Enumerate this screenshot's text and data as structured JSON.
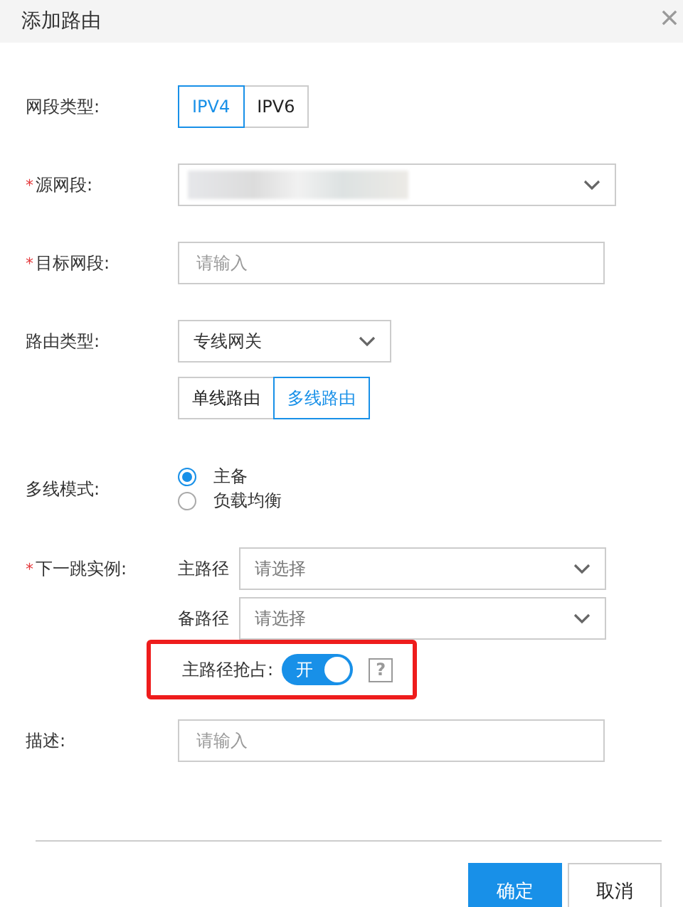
{
  "dialog": {
    "title": "添加路由"
  },
  "segment_type": {
    "label": "网段类型:",
    "options": [
      {
        "label": "IPV4",
        "selected": true
      },
      {
        "label": "IPV6",
        "selected": false
      }
    ]
  },
  "source_segment": {
    "mark": "*",
    "label": "源网段:"
  },
  "target_segment": {
    "mark": "*",
    "label": "目标网段:",
    "placeholder": "请输入"
  },
  "route_type": {
    "label": "路由类型:",
    "value": "专线网关",
    "options": [
      {
        "label": "单线路由",
        "selected": false
      },
      {
        "label": "多线路由",
        "selected": true
      }
    ]
  },
  "multi_mode": {
    "label": "多线模式:",
    "options": [
      {
        "label": "主备",
        "selected": true
      },
      {
        "label": "负载均衡",
        "selected": false
      }
    ]
  },
  "next_hop": {
    "mark": "*",
    "label": "下一跳实例:",
    "paths": [
      {
        "label": "主路径",
        "placeholder": "请选择"
      },
      {
        "label": "备路径",
        "placeholder": "请选择"
      }
    ],
    "preempt": {
      "label": "主路径抢占:",
      "on": true,
      "switch_text": "开",
      "help": "?",
      "highlighted": true
    }
  },
  "description": {
    "label": "描述:",
    "placeholder": "请输入"
  },
  "buttons": [
    {
      "label": "确定",
      "kind": "primary"
    },
    {
      "label": "取消",
      "kind": "default"
    }
  ]
}
